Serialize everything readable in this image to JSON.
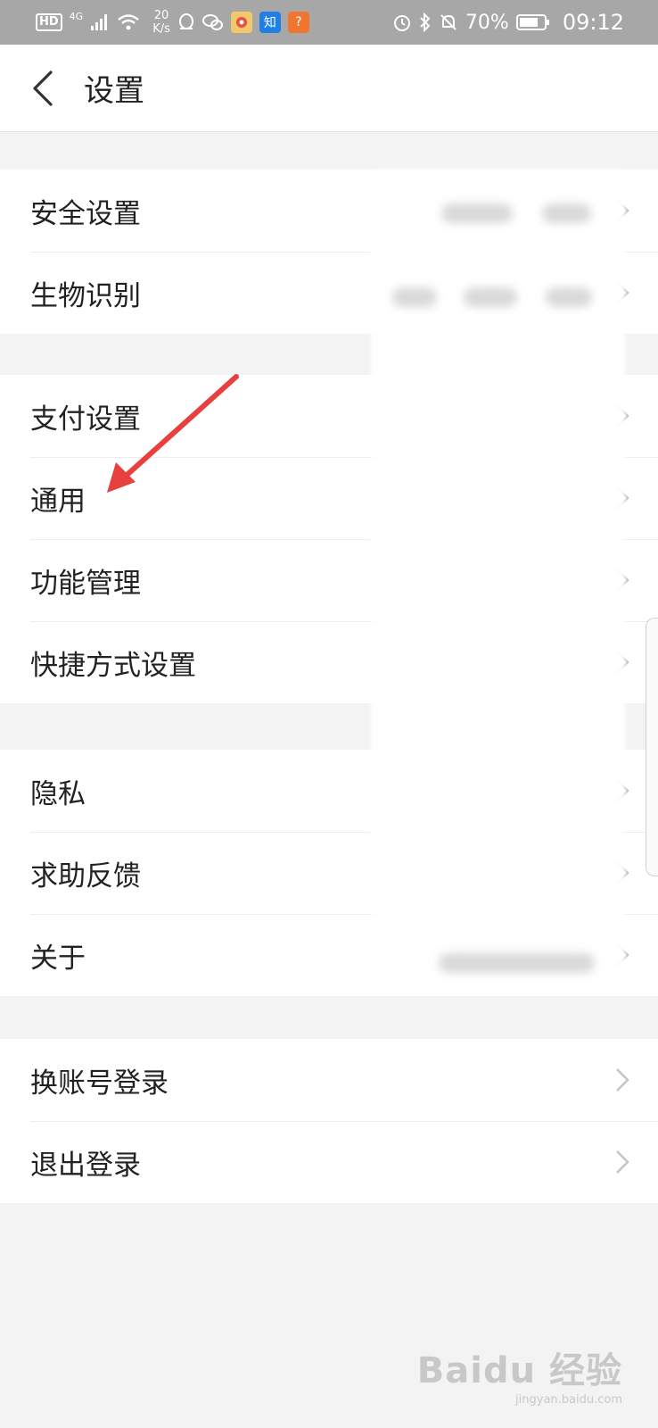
{
  "status_bar": {
    "hd": "HD",
    "signal": "4G",
    "speed_value": "20",
    "speed_unit": "K/s",
    "app1": "知",
    "app2": "?",
    "battery": "70%",
    "time": "09:12"
  },
  "header": {
    "title": "设置"
  },
  "groups": [
    {
      "items": [
        "安全设置",
        "生物识别"
      ]
    },
    {
      "items": [
        "支付设置",
        "通用",
        "功能管理",
        "快捷方式设置"
      ]
    },
    {
      "items": [
        "隐私",
        "求助反馈",
        "关于"
      ]
    },
    {
      "items": [
        "换账号登录",
        "退出登录"
      ]
    }
  ],
  "colors": {
    "annotation_arrow": "#e8403f",
    "chevron": "#c4c4c4",
    "status_bar_bg": "#a7a7a7"
  },
  "watermark": {
    "main": "Baidu 经验",
    "sub": "jingyan.baidu.com"
  }
}
